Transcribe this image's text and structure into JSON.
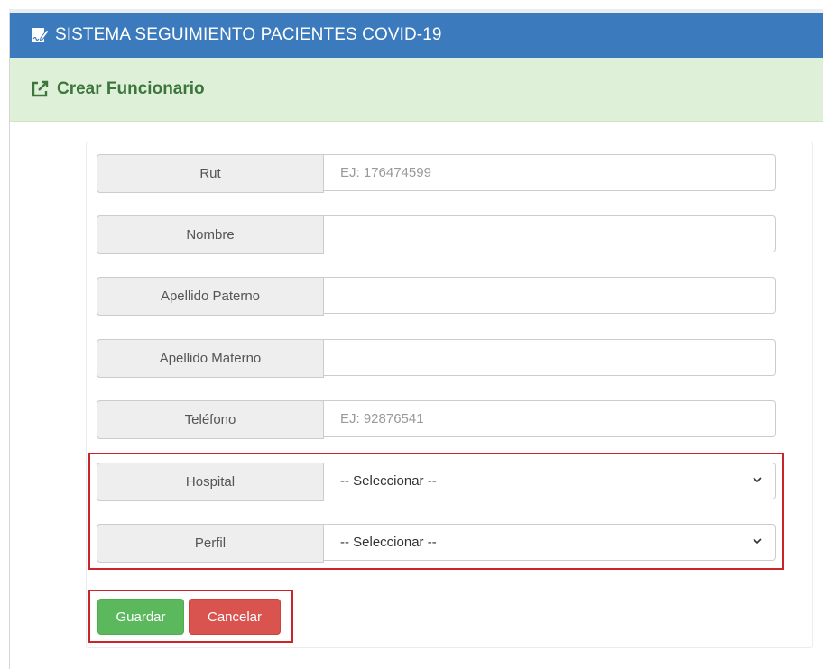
{
  "navbar": {
    "title": "SISTEMA SEGUIMIENTO PACIENTES COVID-19",
    "icon": "signature-edit-icon"
  },
  "subheader": {
    "title": "Crear Funcionario",
    "icon": "external-link-edit-icon"
  },
  "form": {
    "rut": {
      "label": "Rut",
      "value": "",
      "placeholder": "EJ: 176474599"
    },
    "nombre": {
      "label": "Nombre",
      "value": "",
      "placeholder": ""
    },
    "apellido_paterno": {
      "label": "Apellido Paterno",
      "value": "",
      "placeholder": ""
    },
    "apellido_materno": {
      "label": "Apellido Materno",
      "value": "",
      "placeholder": ""
    },
    "telefono": {
      "label": "Teléfono",
      "value": "",
      "placeholder": "EJ: 92876541"
    },
    "hospital": {
      "label": "Hospital",
      "selected": "-- Seleccionar --"
    },
    "perfil": {
      "label": "Perfil",
      "selected": "-- Seleccionar --"
    }
  },
  "buttons": {
    "save": "Guardar",
    "cancel": "Cancelar"
  },
  "colors": {
    "navbar": "#3a7abd",
    "subheader_bg": "#dff0d8",
    "subheader_text": "#3c763d",
    "save": "#5cb85c",
    "cancel": "#d9534f",
    "highlight": "#c8262a"
  }
}
